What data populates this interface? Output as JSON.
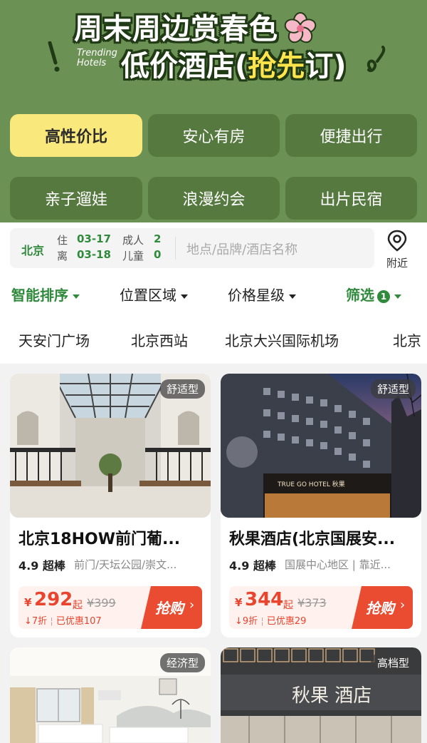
{
  "banner": {
    "title1": "周末周边赏春色",
    "trending": [
      "Trending",
      "Hotels"
    ],
    "title2_a": "低价酒店(",
    "title2_hl": "抢先",
    "title2_b": "订)"
  },
  "categories": [
    "高性价比",
    "安心有房",
    "便捷出行",
    "亲子遛娃",
    "浪漫约会",
    "出片民宿"
  ],
  "search": {
    "city": "北京",
    "checkin_label": "住",
    "checkin": "03-17",
    "checkout_label": "离",
    "checkout": "03-18",
    "adults_label": "成人",
    "adults": "2",
    "children_label": "儿童",
    "children": "0",
    "placeholder": "地点/品牌/酒店名称",
    "nearby": "附近"
  },
  "sort": {
    "smart": "智能排序",
    "location": "位置区域",
    "price_star": "价格星级",
    "filter": "筛选",
    "filter_count": "1"
  },
  "landmarks": [
    "天安门广场",
    "北京西站",
    "北京大兴国际机场",
    "北京"
  ],
  "hotels": [
    {
      "tag": "舒适型",
      "name": "北京18HOW前门葡...",
      "score": "4.9",
      "score_label": "超棒",
      "location": "前门/天坛公园/崇文...",
      "currency": "¥",
      "price": "292",
      "qi": "起",
      "original": "¥399",
      "discount": "7折",
      "saved": "已优惠107",
      "buy": "抢购"
    },
    {
      "tag": "舒适型",
      "name": "秋果酒店(北京国展安...",
      "score": "4.9",
      "score_label": "超棒",
      "location": "国展中心地区 | 靠近...",
      "currency": "¥",
      "price": "344",
      "qi": "起",
      "original": "¥373",
      "discount": "9折",
      "saved": "已优惠29",
      "buy": "抢购",
      "sign": "TRUE GO HOTEL 秋果"
    },
    {
      "tag": "经济型"
    },
    {
      "tag": "高档型",
      "sign": "秋果 酒店"
    }
  ],
  "colors": {
    "banner_bg": "#6b9154",
    "accent_green": "#2f8a3b",
    "price_red": "#e8442e",
    "active_cat": "#f9e87c"
  }
}
